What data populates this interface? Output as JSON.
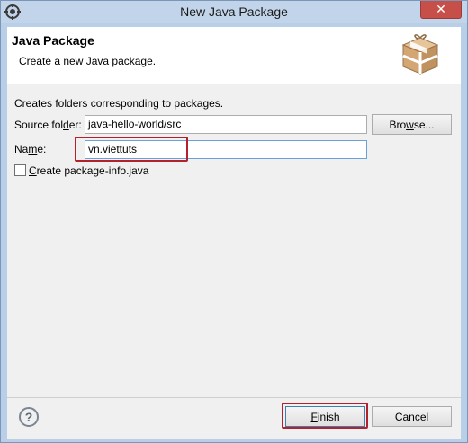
{
  "window": {
    "title": "New Java Package",
    "close_glyph": "✕"
  },
  "banner": {
    "title": "Java Package",
    "description": "Create a new Java package.",
    "icon": "package-icon"
  },
  "form": {
    "intro": "Creates folders corresponding to packages.",
    "source_folder": {
      "label_pre": "Source fol",
      "label_mnemonic": "d",
      "label_post": "er:",
      "value": "java-hello-world/src"
    },
    "browse_label_pre": "Bro",
    "browse_label_mnemonic": "w",
    "browse_label_post": "se...",
    "name": {
      "label_pre": "Na",
      "label_mnemonic": "m",
      "label_post": "e:",
      "value": "vn.viettuts"
    },
    "package_info": {
      "label_mnemonic": "C",
      "label_post": "reate package-info.java",
      "checked": false
    }
  },
  "footer": {
    "help_glyph": "?",
    "finish_mnemonic": "F",
    "finish_post": "inish",
    "cancel_label": "Cancel"
  },
  "colors": {
    "highlight": "#b3222b",
    "titlebar": "#c1d4ea",
    "close": "#c74f4a"
  }
}
